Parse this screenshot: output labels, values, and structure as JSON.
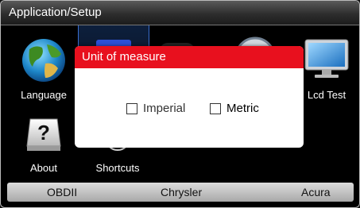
{
  "title": "Application/Setup",
  "tiles": {
    "language": "Language",
    "lcd_test": "Lcd Test",
    "about": "About",
    "shortcuts": "Shortcuts"
  },
  "dialog": {
    "title": "Unit of measure",
    "option_imperial": "Imperial",
    "option_metric": "Metric"
  },
  "bottom_bar": {
    "left": "OBDII",
    "center": "Chrysler",
    "right": "Acura"
  },
  "colors": {
    "dialog_header": "#e8101e",
    "selection": "#3a6fd0"
  }
}
